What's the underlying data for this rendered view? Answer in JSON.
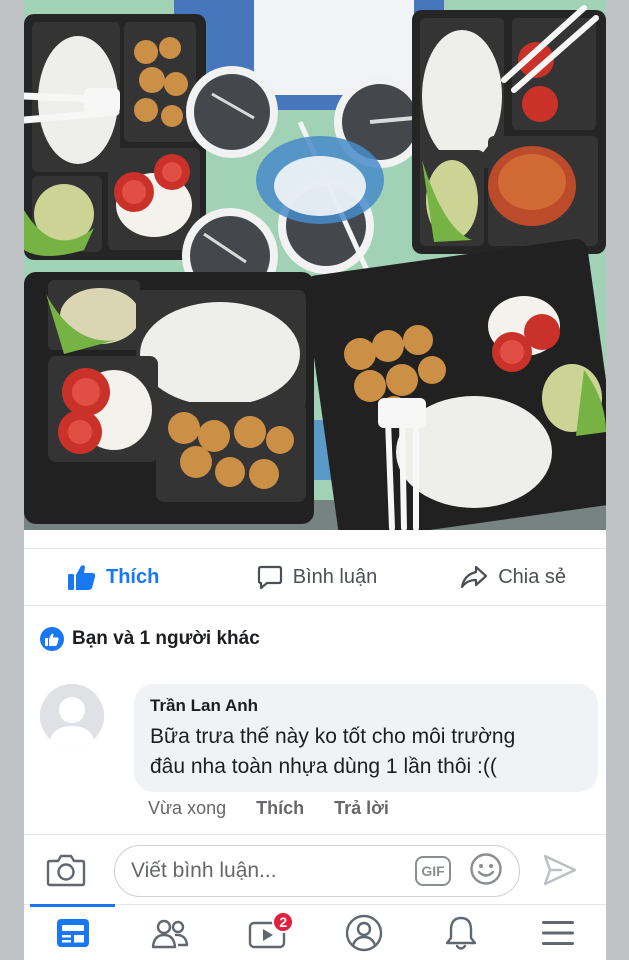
{
  "actions": {
    "like": "Thích",
    "comment": "Bình luận",
    "share": "Chia sẻ"
  },
  "reactions": {
    "summary": "Bạn và 1 người khác"
  },
  "comment": {
    "author": "Trần Lan Anh",
    "text_line1": "Bữa trưa thế này ko tốt cho môi trường",
    "text_line2": "đâu nha toàn nhựa dùng 1 lần thôi :((",
    "time": "Vừa xong",
    "like": "Thích",
    "reply": "Trả lời"
  },
  "composer": {
    "placeholder": "Viết bình luận...",
    "gif": "GIF"
  },
  "tabbar": {
    "watch_badge": "2",
    "icons": [
      "news-feed-icon",
      "friends-icon",
      "watch-icon",
      "profile-icon",
      "notifications-icon",
      "menu-icon"
    ]
  },
  "colors": {
    "accent": "#1877f2",
    "badge": "#e41e3f",
    "muted": "#65676b"
  }
}
